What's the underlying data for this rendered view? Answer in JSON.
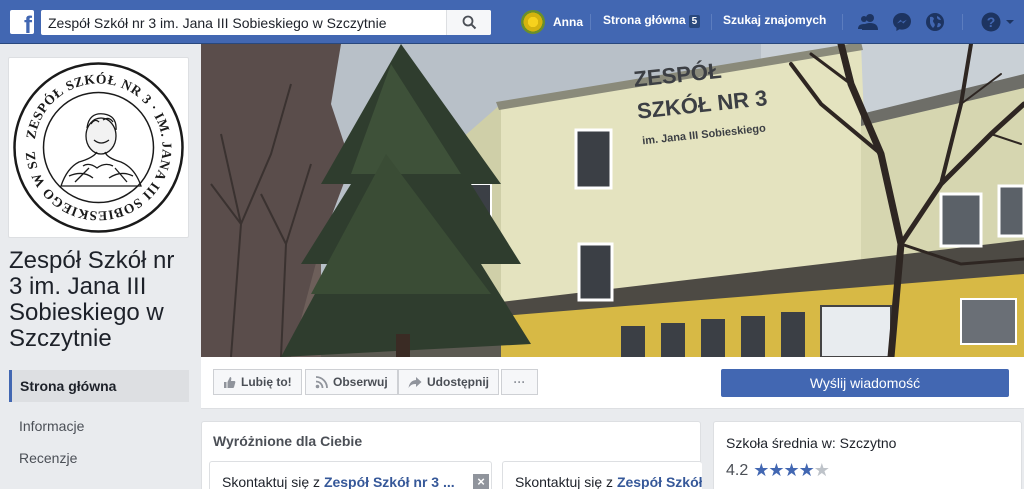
{
  "topbar": {
    "logo": "f",
    "search_value": "Zespół Szkół nr 3 im. Jana III Sobieskiego w Szczytnie",
    "user_name": "Anna",
    "home_label": "Strona główna",
    "home_badge": "5",
    "find_friends_label": "Szukaj znajomych",
    "icons": [
      "friend-requests-icon",
      "messenger-icon",
      "notifications-icon",
      "help-icon"
    ]
  },
  "page": {
    "name": "Zespół Szkół nr 3 im. Jana III Sobieskiego w Szczytnie"
  },
  "left_nav": {
    "items": [
      {
        "label": "Strona główna",
        "active": true
      },
      {
        "label": "Informacje",
        "active": false
      },
      {
        "label": "Recenzje",
        "active": false
      }
    ]
  },
  "actions": {
    "like": "Lubię to!",
    "follow": "Obserwuj",
    "share": "Udostępnij",
    "more": "···",
    "send_message": "Wyślij wiadomość"
  },
  "featured": {
    "title": "Wyróżnione dla Ciebie",
    "cards": [
      {
        "prefix": "Skontaktuj się z ",
        "link": "Zespół Szkół nr 3 ..."
      },
      {
        "prefix": "Skontaktuj się z ",
        "link": "Zespół Szkół"
      }
    ]
  },
  "info": {
    "category": "Szkoła średnia w: Szczytno",
    "rating": "4.2",
    "stars": "★★★★",
    "star_partial": "★"
  },
  "cover": {
    "sign_line1": "ZESPÓŁ",
    "sign_line2": "SZKÓŁ NR 3",
    "sign_line3": "im. Jana III Sobieskiego"
  },
  "logo_seal": {
    "text": "ZESPÓŁ SZKÓŁ NR 3 IM. JANA III SOBIESKIEGO W SZCZYTNIE"
  },
  "colors": {
    "brand": "#4267b2",
    "link": "#365899",
    "background": "#e9ebee"
  }
}
